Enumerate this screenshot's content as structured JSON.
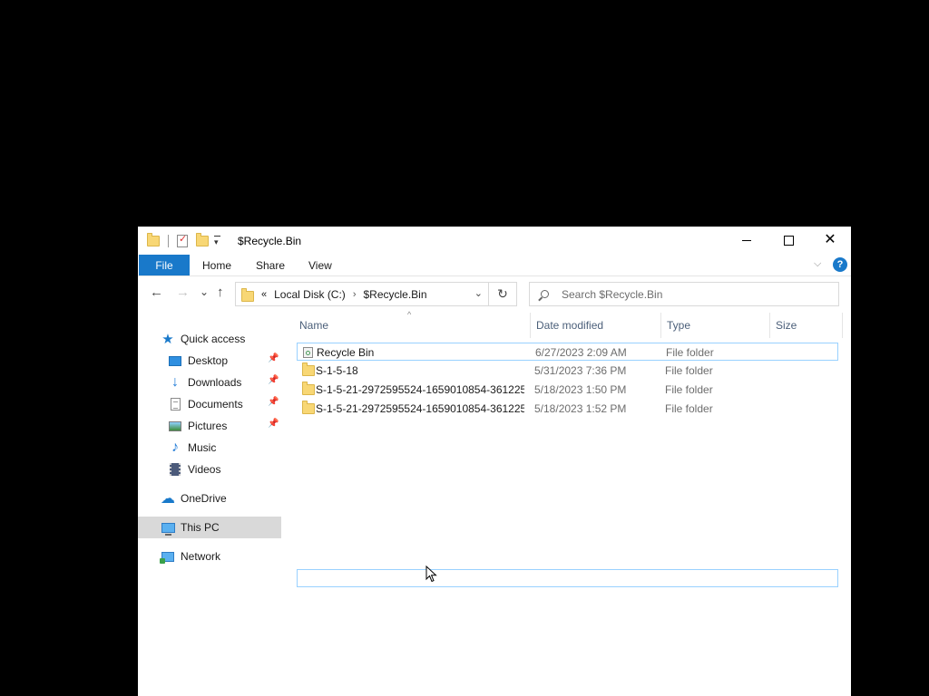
{
  "window": {
    "title": "$Recycle.Bin",
    "close_glyph": "✕"
  },
  "ribbon": {
    "tabs": [
      "File",
      "Home",
      "Share",
      "View"
    ],
    "help_glyph": "?",
    "expand_glyph": "⌵"
  },
  "navbar": {
    "back_glyph": "←",
    "forward_glyph": "→",
    "recent_glyph": "⌄",
    "up_glyph": "↑",
    "overflow_glyph": "«",
    "breadcrumb": [
      "Local Disk (C:)",
      "$Recycle.Bin"
    ],
    "crumb_separator": "›",
    "dropdown_glyph": "⌄",
    "refresh_glyph": "↻",
    "search_placeholder": "Search $Recycle.Bin"
  },
  "navpane": {
    "pin_glyph": "📌",
    "items": [
      {
        "label": "Quick access",
        "icon": "quick-access-star-icon"
      },
      {
        "label": "Desktop",
        "icon": "desktop-icon",
        "pinned": true
      },
      {
        "label": "Downloads",
        "icon": "downloads-icon",
        "pinned": true
      },
      {
        "label": "Documents",
        "icon": "documents-icon",
        "pinned": true
      },
      {
        "label": "Pictures",
        "icon": "pictures-icon",
        "pinned": true
      },
      {
        "label": "Music",
        "icon": "music-icon"
      },
      {
        "label": "Videos",
        "icon": "videos-icon"
      },
      {
        "label": "OneDrive",
        "icon": "onedrive-cloud-icon"
      },
      {
        "label": "This PC",
        "icon": "this-pc-icon",
        "selected": true
      },
      {
        "label": "Network",
        "icon": "network-icon"
      }
    ]
  },
  "filelist": {
    "sort_glyph": "^",
    "columns": [
      "Name",
      "Date modified",
      "Type",
      "Size"
    ],
    "rows": [
      {
        "name": "Recycle Bin",
        "date": "6/27/2023 2:09 AM",
        "type": "File folder",
        "icon": "recycle-bin-icon",
        "focused": true
      },
      {
        "name": "S-1-5-18",
        "date": "5/31/2023 7:36 PM",
        "type": "File folder",
        "icon": "folder-icon"
      },
      {
        "name": "S-1-5-21-2972595524-1659010854-361225...",
        "date": "5/18/2023 1:50 PM",
        "type": "File folder",
        "icon": "folder-icon"
      },
      {
        "name": "S-1-5-21-2972595524-1659010854-361225...",
        "date": "5/18/2023 1:52 PM",
        "type": "File folder",
        "icon": "folder-icon"
      }
    ]
  },
  "colors": {
    "accent": "#1979ca",
    "selection": "#d9d9d9",
    "focus_border": "#99d1ff",
    "folder": "#f8d775",
    "background": "#000000"
  }
}
